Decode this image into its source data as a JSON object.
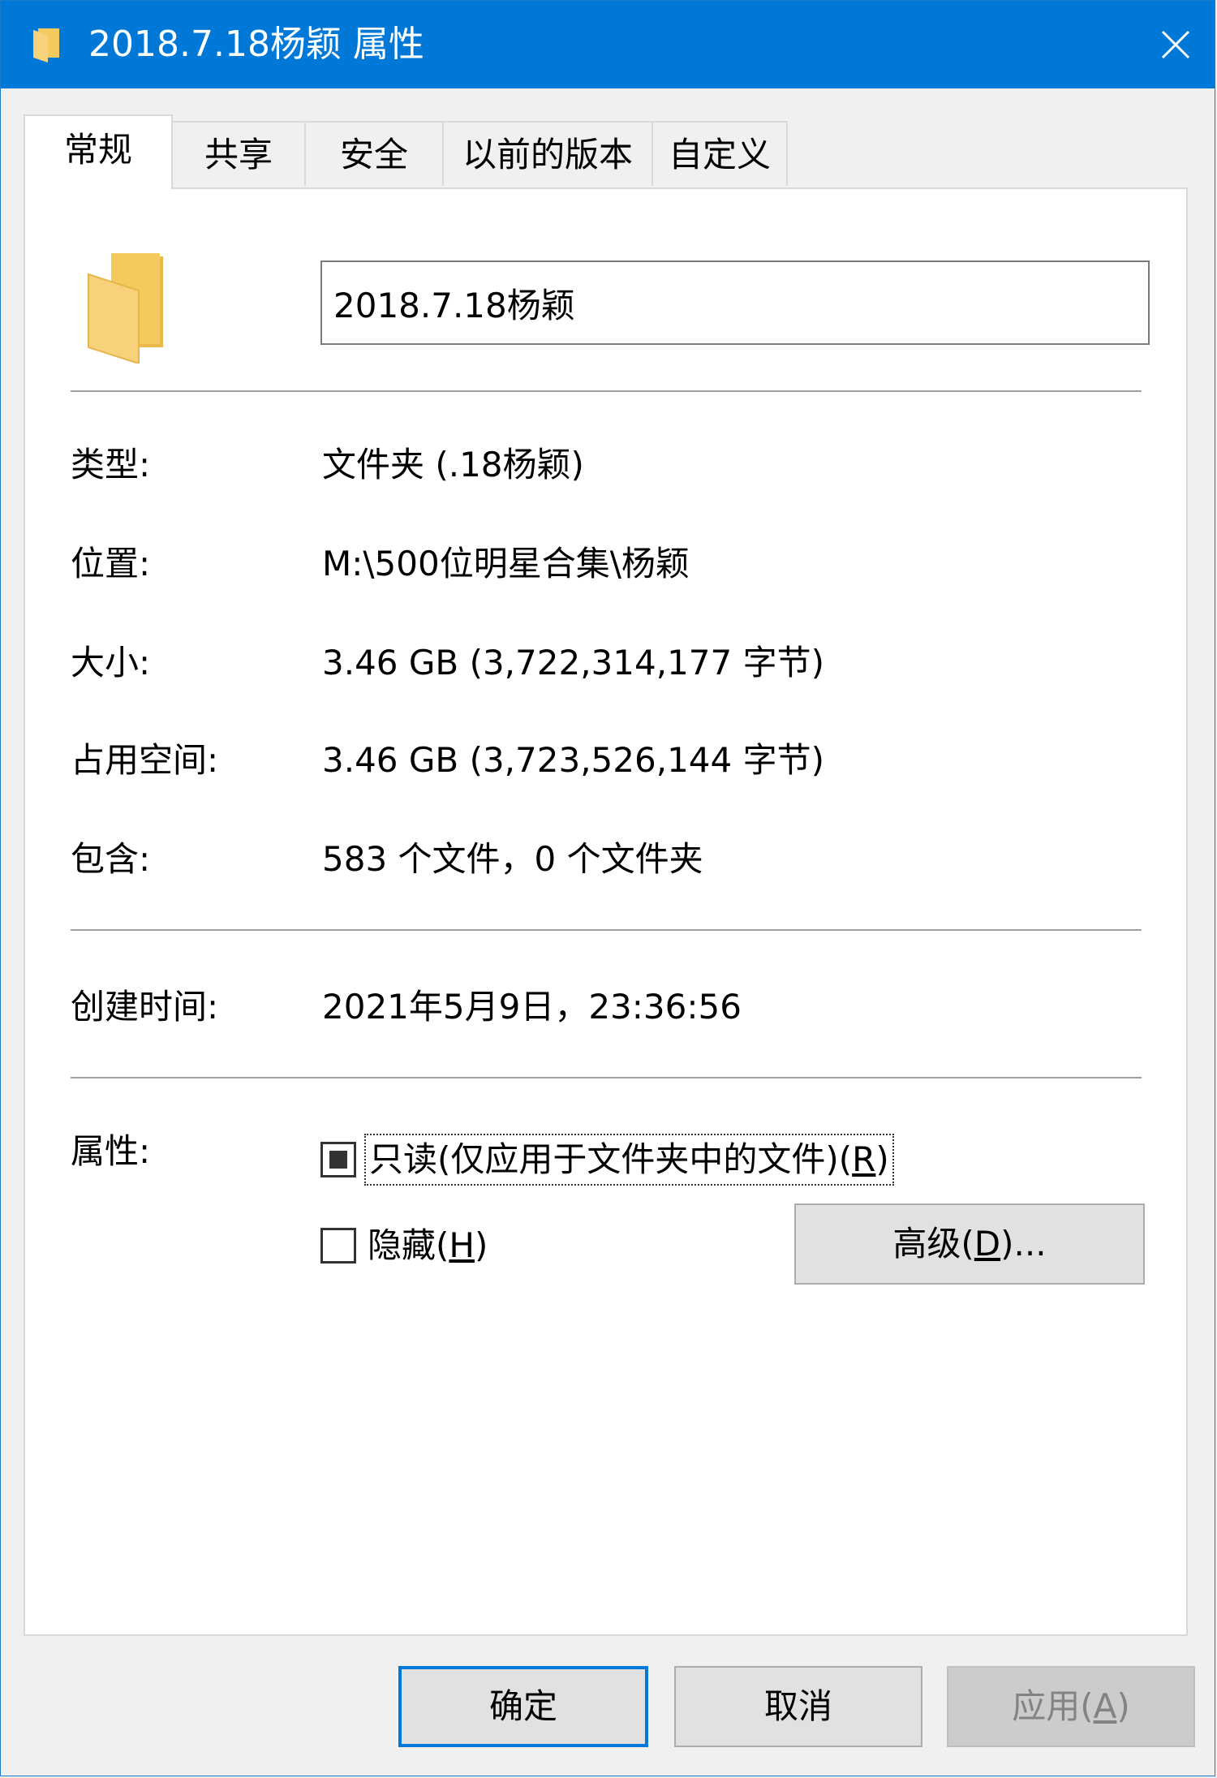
{
  "window": {
    "title": "2018.7.18杨颖 属性",
    "colors": {
      "titlebar": "#0078d7",
      "folder": "#f4c95d"
    }
  },
  "tabs": [
    {
      "label": "常规",
      "active": true
    },
    {
      "label": "共享"
    },
    {
      "label": "安全"
    },
    {
      "label": "以前的版本"
    },
    {
      "label": "自定义"
    }
  ],
  "general": {
    "name_value": "2018.7.18杨颖",
    "properties": [
      {
        "label": "类型:",
        "value": "文件夹 (.18杨颖)"
      },
      {
        "label": "位置:",
        "value": "M:\\500位明星合集\\杨颖"
      },
      {
        "label": "大小:",
        "value": "3.46 GB (3,722,314,177 字节)"
      },
      {
        "label": "占用空间:",
        "value": "3.46 GB (3,723,526,144 字节)"
      },
      {
        "label": "包含:",
        "value": "583 个文件，0 个文件夹"
      }
    ],
    "created": {
      "label": "创建时间:",
      "value": "2021年5月9日，23:36:56"
    },
    "attributes": {
      "label": "属性:",
      "readonly": {
        "text": "只读(仅应用于文件夹中的文件)(",
        "key": "R",
        "suffix": ")",
        "state": "indeterminate"
      },
      "hidden": {
        "text": "隐藏(",
        "key": "H",
        "suffix": ")",
        "state": "unchecked"
      },
      "advanced": {
        "text": "高级(",
        "key": "D",
        "suffix": ")..."
      }
    }
  },
  "footer": {
    "ok": "确定",
    "cancel": "取消",
    "apply": {
      "text": "应用(",
      "key": "A",
      "suffix": ")"
    }
  }
}
